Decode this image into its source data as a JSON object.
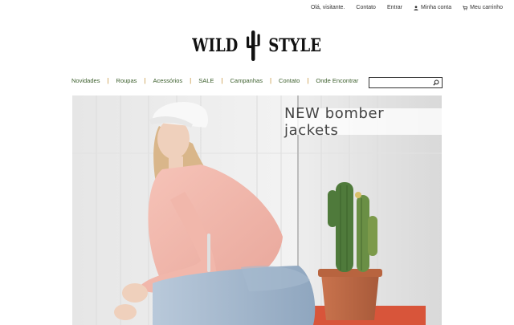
{
  "topbar": {
    "greeting": "Olá, visitante.",
    "contact": "Contato",
    "login": "Entrar",
    "account": "Minha conta",
    "cart": "Meu carrinho"
  },
  "logo": {
    "left_word": "WILD",
    "right_word": "STYLE"
  },
  "nav": {
    "items": [
      "Novidades",
      "Roupas",
      "Acessórios",
      "SALE",
      "Campanhas",
      "Contato",
      "Onde Encontrar"
    ]
  },
  "search": {
    "placeholder": "",
    "value": ""
  },
  "hero": {
    "caption": "NEW bomber jackets"
  },
  "colors": {
    "nav_text": "#3b5e2b",
    "nav_separator": "#c08a2a"
  }
}
